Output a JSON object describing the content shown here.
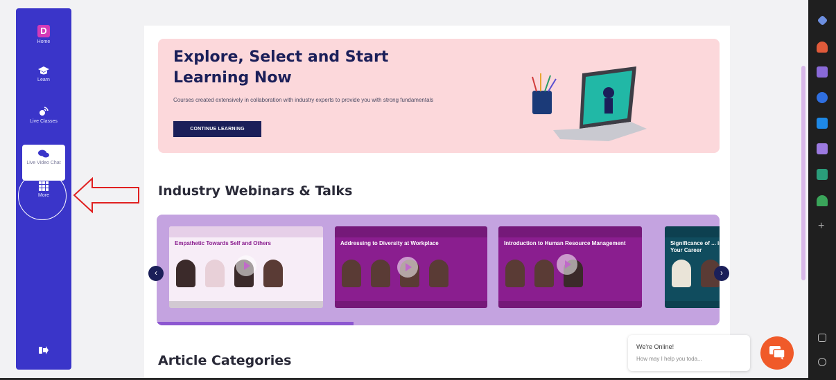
{
  "sidebar": {
    "logo_letter": "D",
    "items": [
      {
        "label": "Home",
        "icon": "logo-icon"
      },
      {
        "label": "Learn",
        "icon": "graduation-cap-icon"
      },
      {
        "label": "Live Classes",
        "icon": "live-classes-icon"
      },
      {
        "label": "Live Video Chat",
        "icon": "chat-bubbles-icon"
      },
      {
        "label": "More",
        "icon": "grid-icon"
      }
    ],
    "logout_icon": "logout-icon",
    "color": "#3a35c9"
  },
  "hero": {
    "title": "Explore, Select and Start Learning Now",
    "subtitle": "Courses created extensively in collaboration with industry experts to provide you with strong fundamentals",
    "button_label": "CONTINUE LEARNING",
    "background": "#fcd8db",
    "title_color": "#1b1f59"
  },
  "webinars": {
    "heading": "Industry Webinars & Talks",
    "cards": [
      {
        "title": "Empathetic Towards Self and Others"
      },
      {
        "title": "Addressing to Diversity at Workplace"
      },
      {
        "title": "Introduction to Human Resource Management"
      },
      {
        "title": "Significance of ... in Your Career"
      }
    ],
    "progress": 0.35
  },
  "articles": {
    "heading": "Article Categories"
  },
  "chat": {
    "status": "We're Online!",
    "prompt": "How may I help you toda...",
    "accent": "#f05a29"
  }
}
